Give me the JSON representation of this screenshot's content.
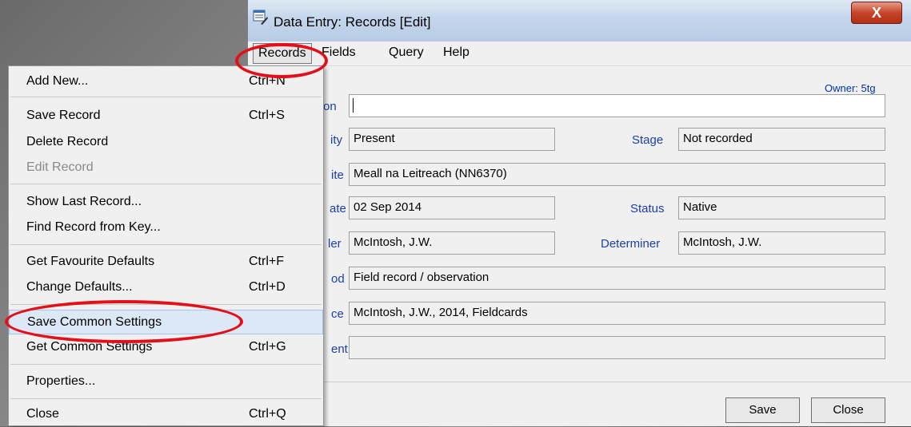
{
  "window": {
    "title": "Data Entry: Records [Edit]",
    "close_glyph": "X",
    "owner_label": "Owner: 5tg"
  },
  "menubar": {
    "items": [
      {
        "label": "Records"
      },
      {
        "label": "Fields"
      },
      {
        "label": "Query"
      },
      {
        "label": "Help"
      }
    ]
  },
  "dropdown": {
    "items": [
      {
        "label": "Add New...",
        "shortcut": "Ctrl+N"
      },
      {
        "label": "Save Record",
        "shortcut": "Ctrl+S"
      },
      {
        "label": "Delete Record",
        "shortcut": ""
      },
      {
        "label": "Edit Record",
        "shortcut": "",
        "disabled": true
      },
      {
        "label": "Show Last Record...",
        "shortcut": ""
      },
      {
        "label": "Find Record from Key...",
        "shortcut": ""
      },
      {
        "label": "Get Favourite Defaults",
        "shortcut": "Ctrl+F"
      },
      {
        "label": "Change Defaults...",
        "shortcut": "Ctrl+D"
      },
      {
        "label": "Save Common Settings",
        "shortcut": "",
        "highlighted": true
      },
      {
        "label": "Get Common Settings",
        "shortcut": "Ctrl+G"
      },
      {
        "label": "Properties...",
        "shortcut": ""
      },
      {
        "label": "Close",
        "shortcut": "Ctrl+Q"
      }
    ]
  },
  "form": {
    "labels": {
      "taxon_fragment": "on",
      "quantity_fragment": "ity",
      "stage": "Stage",
      "site_fragment": "ite",
      "date_fragment": "ate",
      "status": "Status",
      "recorder_fragment": "ler",
      "determiner": "Determiner",
      "method_fragment": "od",
      "source_fragment": "ce",
      "comment_fragment": "ent"
    },
    "values": {
      "taxon": "",
      "quantity": "Present",
      "stage": "Not recorded",
      "site": "Meall na Leitreach  (NN6370)",
      "date": "02 Sep 2014",
      "status": "Native",
      "recorder": "McIntosh, J.W.",
      "determiner": "McIntosh, J.W.",
      "method": "Field record / observation",
      "source": "McIntosh, J.W., 2014, Fieldcards",
      "comment": ""
    }
  },
  "buttons": {
    "save_label": "Save",
    "close_label": "Close"
  },
  "colors": {
    "annotation_ring": "#e3101a",
    "label_blue": "#1b3fae"
  }
}
